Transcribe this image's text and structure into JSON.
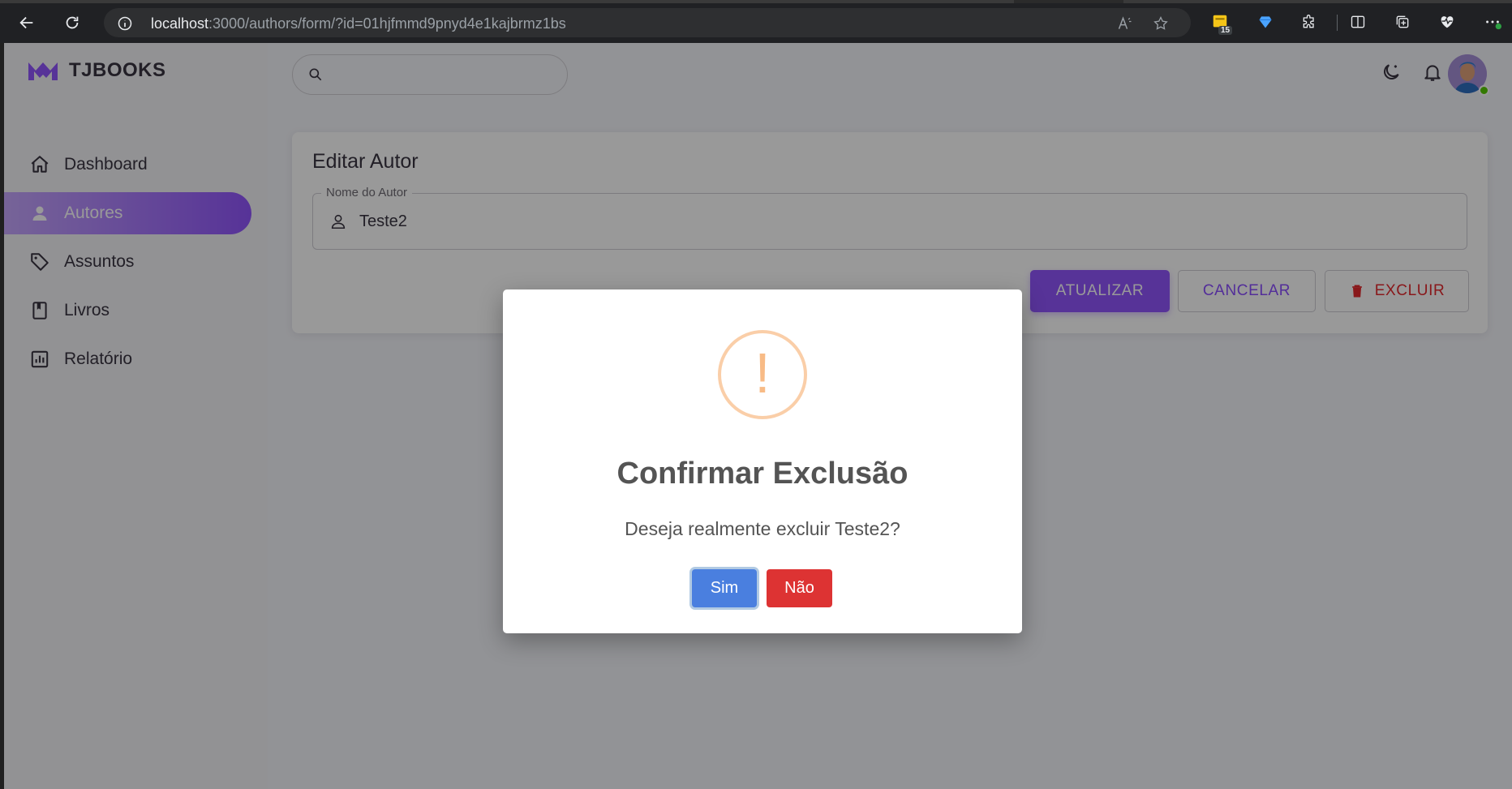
{
  "browser": {
    "url_host": "localhost",
    "url_path": ":3000/authors/form/?id=01hjfmmd9pnyd4e1kajbrmz1bs",
    "extension_badge": "15"
  },
  "app": {
    "brand": "TJBOOKS",
    "accent_color": "#9155fd",
    "sidebar": {
      "items": [
        {
          "label": "Dashboard",
          "icon": "home-icon"
        },
        {
          "label": "Autores",
          "icon": "person-icon",
          "active": true
        },
        {
          "label": "Assuntos",
          "icon": "tag-icon"
        },
        {
          "label": "Livros",
          "icon": "book-icon"
        },
        {
          "label": "Relatório",
          "icon": "chart-icon"
        }
      ]
    },
    "search": {
      "placeholder": ""
    }
  },
  "form": {
    "title": "Editar Autor",
    "name_field": {
      "label": "Nome do Autor",
      "value": "Teste2"
    },
    "buttons": {
      "update": "ATUALIZAR",
      "cancel": "CANCELAR",
      "delete": "EXCLUIR"
    }
  },
  "dialog": {
    "icon": "warning-icon",
    "icon_glyph": "!",
    "title": "Confirmar Exclusão",
    "message": "Deseja realmente excluir Teste2?",
    "confirm": "Sim",
    "deny": "Não",
    "confirm_color": "#4a7fdf",
    "deny_color": "#dd3333"
  }
}
